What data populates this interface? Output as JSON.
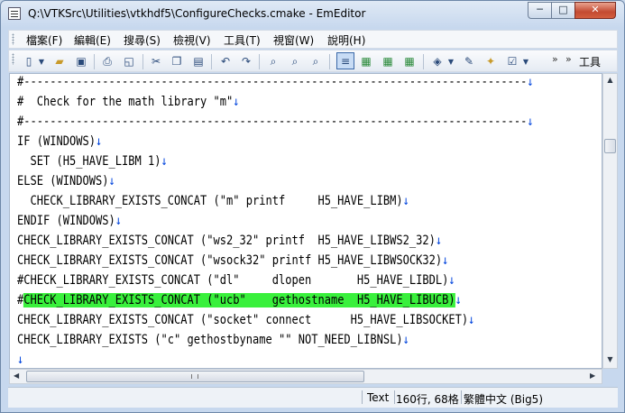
{
  "window": {
    "title": "Q:\\VTKSrc\\Utilities\\vtkhdf5\\ConfigureChecks.cmake - EmEditor",
    "controls": {
      "minimize": "─",
      "maximize": "□",
      "close": "✕"
    }
  },
  "menu": {
    "items": [
      "檔案(F)",
      "編輯(E)",
      "搜尋(S)",
      "檢視(V)",
      "工具(T)",
      "視窗(W)",
      "說明(H)"
    ]
  },
  "toolbar": {
    "icons": [
      "new-file-icon",
      "new-dropdown-icon",
      "open-folder-icon",
      "save-icon",
      "print-icon",
      "print-preview-icon",
      "cut-icon",
      "copy-icon",
      "paste-icon",
      "undo-icon",
      "redo-icon",
      "find-icon",
      "find-next-icon",
      "find-prev-icon",
      "wrap-none-icon",
      "wrap-window-icon",
      "wrap-char-icon",
      "wrap-page-icon",
      "encoding-icon",
      "encoding-dropdown-icon",
      "customize-icon",
      "properties-icon",
      "checkbox-icon",
      "checkbox-dropdown-icon"
    ],
    "more1": "»",
    "more2": "»",
    "tools_label": "工具"
  },
  "editor": {
    "newline_mark": "↓",
    "lines": [
      "#-----------------------------------------------------------------------------",
      "#  Check for the math library \"m\"",
      "#-----------------------------------------------------------------------------",
      "IF (WINDOWS)",
      "  SET (H5_HAVE_LIBM 1)",
      "ELSE (WINDOWS)",
      "  CHECK_LIBRARY_EXISTS_CONCAT (\"m\" printf     H5_HAVE_LIBM)",
      "ENDIF (WINDOWS)",
      "CHECK_LIBRARY_EXISTS_CONCAT (\"ws2_32\" printf  H5_HAVE_LIBWS2_32)",
      "CHECK_LIBRARY_EXISTS_CONCAT (\"wsock32\" printf H5_HAVE_LIBWSOCK32)",
      "#CHECK_LIBRARY_EXISTS_CONCAT (\"dl\"     dlopen       H5_HAVE_LIBDL)",
      "#",
      "CHECK_LIBRARY_EXISTS_CONCAT (\"socket\" connect      H5_HAVE_LIBSOCKET)",
      "CHECK_LIBRARY_EXISTS (\"c\" gethostbyname \"\" NOT_NEED_LIBNSL)",
      ""
    ],
    "highlighted_text": "CHECK_LIBRARY_EXISTS_CONCAT (\"ucb\"    gethostname  H5_HAVE_LIBUCB)",
    "highlight_color": "#39f03c"
  },
  "scroll": {
    "up": "▲",
    "down": "▼",
    "left": "◀",
    "right": "▶"
  },
  "status": {
    "mode": "Text",
    "position": "160行, 68格",
    "encoding": "繁體中文 (Big5)"
  }
}
